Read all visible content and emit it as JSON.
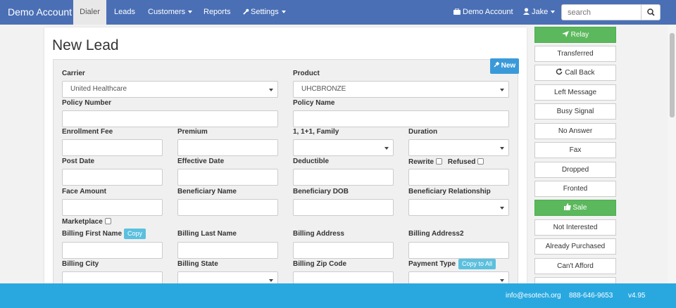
{
  "navbar": {
    "brand": "Demo Account",
    "items": [
      "Dialer",
      "Leads",
      "Customers",
      "Reports",
      "Settings"
    ],
    "account_label": "Demo Account",
    "user_label": "Jake",
    "search_placeholder": "search"
  },
  "page": {
    "title": "New Lead",
    "new_button": "New"
  },
  "form": {
    "carrier_label": "Carrier",
    "carrier_value": "United Healthcare",
    "product_label": "Product",
    "product_value": "UHCBRONZE",
    "policy_number_label": "Policy Number",
    "policy_name_label": "Policy Name",
    "enrollment_fee_label": "Enrollment Fee",
    "premium_label": "Premium",
    "family_label": "1, 1+1, Family",
    "duration_label": "Duration",
    "post_date_label": "Post Date",
    "effective_date_label": "Effective Date",
    "deductible_label": "Deductible",
    "rewrite_label": "Rewrite",
    "refused_label": "Refused",
    "face_amount_label": "Face Amount",
    "beneficiary_name_label": "Beneficiary Name",
    "beneficiary_dob_label": "Beneficiary DOB",
    "beneficiary_relationship_label": "Beneficiary Relationship",
    "marketplace_label": "Marketplace",
    "billing_first_name_label": "Billing First Name",
    "copy_label": "Copy",
    "billing_last_name_label": "Billing Last Name",
    "billing_address_label": "Billing Address",
    "billing_address2_label": "Billing Address2",
    "billing_city_label": "Billing City",
    "billing_state_label": "Billing State",
    "billing_zip_label": "Billing Zip Code",
    "payment_type_label": "Payment Type",
    "copy_all_label": "Copy to All"
  },
  "sidebar": {
    "buttons": [
      "Relay",
      "Transferred",
      "Call Back",
      "Left Message",
      "Busy Signal",
      "No Answer",
      "Fax",
      "Dropped",
      "Fronted",
      "Sale",
      "Not Interested",
      "Already Purchased",
      "Can't Afford"
    ]
  },
  "footer": {
    "email": "info@esotech.org",
    "phone": "888-646-9653",
    "version": "v4.95"
  },
  "colors": {
    "navbar": "#4a6fb5",
    "footer": "#29a8e0",
    "green": "#5cb85c",
    "info": "#5bc0de"
  }
}
